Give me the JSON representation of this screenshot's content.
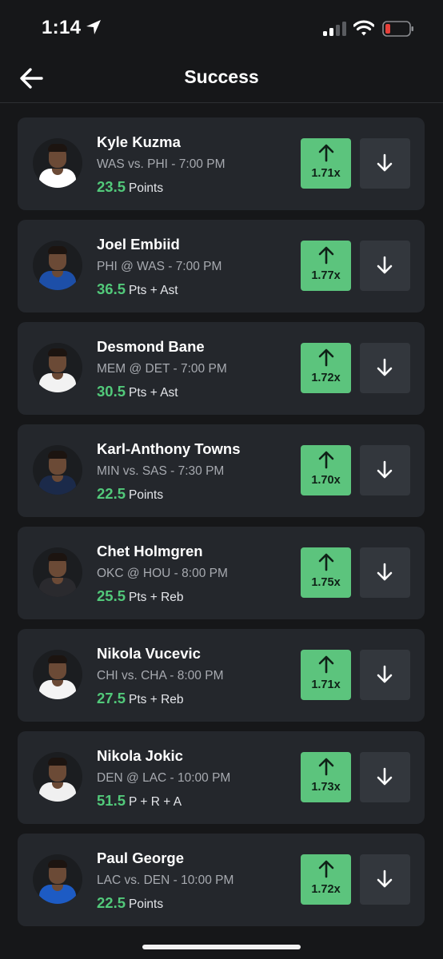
{
  "status_bar": {
    "time": "1:14"
  },
  "nav": {
    "title": "Success"
  },
  "colors": {
    "background": "#161719",
    "card": "#24272c",
    "accent_green": "#5cc47d",
    "line_green": "#52c97a",
    "less_button": "#33373d",
    "battery_low": "#e5403a"
  },
  "icons": {
    "back": "arrow-left-icon",
    "more": "arrow-up-icon",
    "less": "arrow-down-icon",
    "location": "location-arrow-icon",
    "signal": "cellular-signal-icon",
    "wifi": "wifi-icon",
    "battery": "battery-low-icon"
  },
  "props": [
    {
      "player": "Kyle Kuzma",
      "matchup": "WAS vs. PHI  - 7:00 PM",
      "line": "23.5",
      "stat": "Points",
      "multiplier": "1.71x",
      "jersey_color": "#ffffff"
    },
    {
      "player": "Joel Embiid",
      "matchup": "PHI @ WAS  - 7:00 PM",
      "line": "36.5",
      "stat": "Pts + Ast",
      "multiplier": "1.77x",
      "jersey_color": "#1d4fa8"
    },
    {
      "player": "Desmond Bane",
      "matchup": "MEM @ DET  - 7:00 PM",
      "line": "30.5",
      "stat": "Pts + Ast",
      "multiplier": "1.72x",
      "jersey_color": "#f2f2f2"
    },
    {
      "player": "Karl-Anthony Towns",
      "matchup": "MIN vs. SAS  - 7:30 PM",
      "line": "22.5",
      "stat": "Points",
      "multiplier": "1.70x",
      "jersey_color": "#1b2a4a"
    },
    {
      "player": "Chet Holmgren",
      "matchup": "OKC @ HOU  - 8:00 PM",
      "line": "25.5",
      "stat": "Pts + Reb",
      "multiplier": "1.75x",
      "jersey_color": "#2a2a2e"
    },
    {
      "player": "Nikola Vucevic",
      "matchup": "CHI vs. CHA  - 8:00 PM",
      "line": "27.5",
      "stat": "Pts + Reb",
      "multiplier": "1.71x",
      "jersey_color": "#f4f4f4"
    },
    {
      "player": "Nikola Jokic",
      "matchup": "DEN @ LAC  - 10:00 PM",
      "line": "51.5",
      "stat": "P + R + A",
      "multiplier": "1.73x",
      "jersey_color": "#f0f0f0"
    },
    {
      "player": "Paul George",
      "matchup": "LAC vs. DEN  - 10:00 PM",
      "line": "22.5",
      "stat": "Points",
      "multiplier": "1.72x",
      "jersey_color": "#1d5bc4"
    }
  ]
}
